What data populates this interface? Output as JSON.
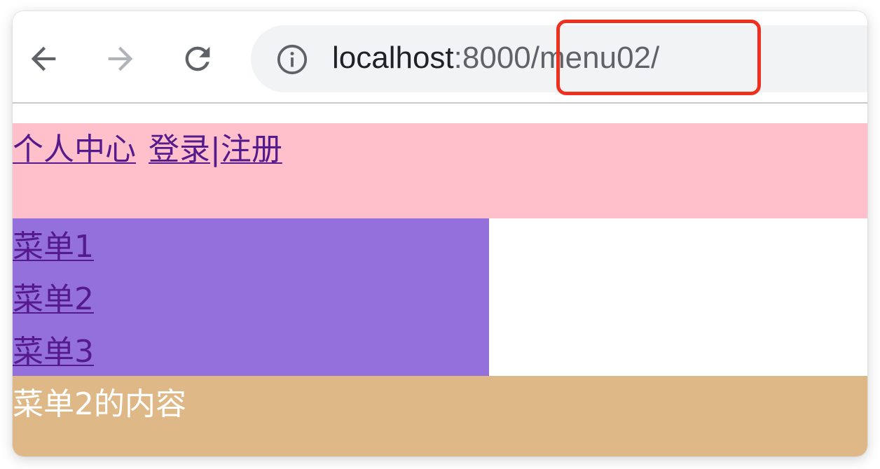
{
  "browser": {
    "back_icon": "arrow-left-icon",
    "forward_icon": "arrow-right-icon",
    "reload_icon": "reload-icon",
    "site_info_icon": "info-icon",
    "address": {
      "host": "localhost",
      "rest": ":8000/menu02/"
    },
    "colors": {
      "highlight": "#f0301e",
      "omnibox_bg": "#f1f3f4"
    }
  },
  "header": {
    "profile_link": "个人中心",
    "login_link": "登录",
    "separator": "|",
    "register_link": "注册",
    "bg_color": "#ffc0cb"
  },
  "menu": {
    "items": [
      {
        "label": "菜单1"
      },
      {
        "label": "菜单2"
      },
      {
        "label": "菜单3"
      }
    ],
    "bg_color": "#9370db"
  },
  "content": {
    "text": "菜单2的内容",
    "bg_color": "#deb887"
  }
}
